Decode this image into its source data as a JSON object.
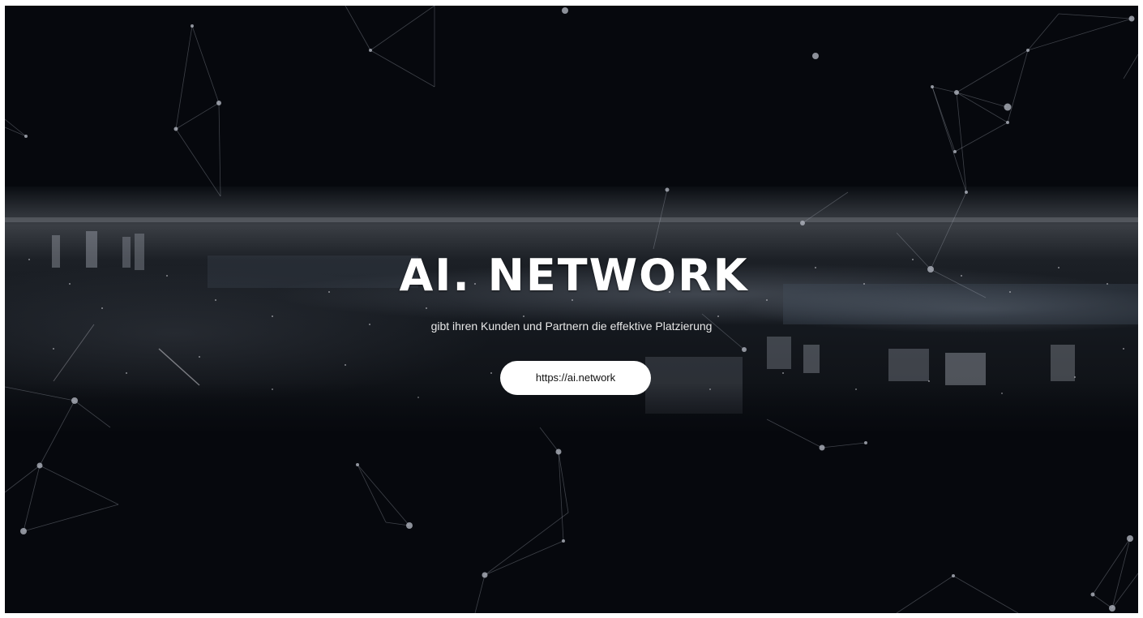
{
  "hero": {
    "title": "AI. NETWORK",
    "tagline": "gibt ihren Kunden und Partnern die effektive Platzierung",
    "cta_label": "https://ai.network"
  },
  "colors": {
    "background": "#06080d",
    "text": "#ffffff",
    "button_bg": "#ffffff",
    "button_text": "#111111"
  }
}
